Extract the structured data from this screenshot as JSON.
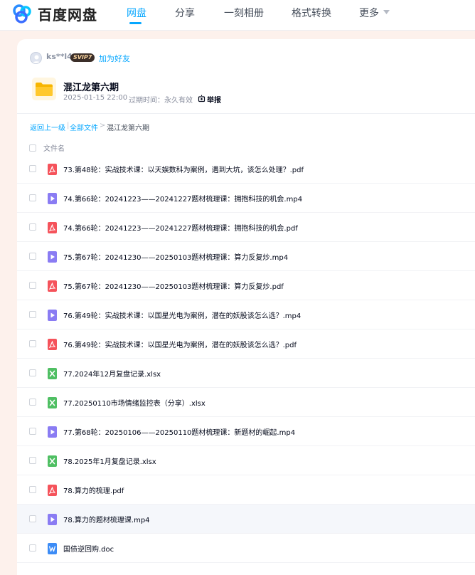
{
  "header": {
    "brand": "百度网盘",
    "nav": [
      {
        "label": "网盘",
        "active": true
      },
      {
        "label": "分享",
        "active": false
      },
      {
        "label": "一刻相册",
        "active": false
      },
      {
        "label": "格式转换",
        "active": false
      },
      {
        "label": "更多",
        "active": false
      }
    ],
    "accent_color": "#06a7ff"
  },
  "share": {
    "username": "ks**l4",
    "vip_badge": "SVIP7",
    "add_friend": "加为好友",
    "title": "混江龙第六期",
    "date": "2025-01-15 22:00",
    "expire": "过期时间：永久有效",
    "report": "举报"
  },
  "breadcrumb": {
    "back": "返回上一级",
    "sep": "|",
    "all": "全部文件",
    "gt": ">",
    "current": "混江龙第六期"
  },
  "list": {
    "column_name": "文件名",
    "files": [
      {
        "name": "73.第48轮：实战技术课：以天娱数科为案例，遇到大坑，该怎么处理？.pdf",
        "icon": "pdf-icon"
      },
      {
        "name": "74.第66轮：20241223——20241227题材梳理课：拥抱科技的机会.mp4",
        "icon": "video-icon"
      },
      {
        "name": "74.第66轮：20241223——20241227题材梳理课：拥抱科技的机会.pdf",
        "icon": "pdf-icon"
      },
      {
        "name": "75.第67轮：20241230——20250103题材梳理课：算力反复炒.mp4",
        "icon": "video-icon"
      },
      {
        "name": "75.第67轮：20241230——20250103题材梳理课：算力反复炒.pdf",
        "icon": "pdf-icon"
      },
      {
        "name": "76.第49轮：实战技术课：以国星光电为案例，潜在的妖股该怎么选？.mp4",
        "icon": "video-icon"
      },
      {
        "name": "76.第49轮：实战技术课：以国星光电为案例，潜在的妖股该怎么选？.pdf",
        "icon": "pdf-icon"
      },
      {
        "name": "77.2024年12月复盘记录.xlsx",
        "icon": "excel-icon"
      },
      {
        "name": "77.20250110市场情绪监控表（分享）.xlsx",
        "icon": "excel-icon"
      },
      {
        "name": "77.第68轮：20250106——20250110题材梳理课：新题材的崛起.mp4",
        "icon": "video-icon"
      },
      {
        "name": "78.2025年1月复盘记录.xlsx",
        "icon": "excel-icon"
      },
      {
        "name": "78.算力的梳理.pdf",
        "icon": "pdf-icon"
      },
      {
        "name": "78.算力的题材梳理课.mp4",
        "icon": "video-icon"
      },
      {
        "name": "国债逆回购.doc",
        "icon": "word-icon"
      }
    ],
    "icon_colors": {
      "pdf-icon": "#f5535b",
      "video-icon": "#8a7cf3",
      "excel-icon": "#4fbf63",
      "word-icon": "#3c8cf6"
    }
  }
}
